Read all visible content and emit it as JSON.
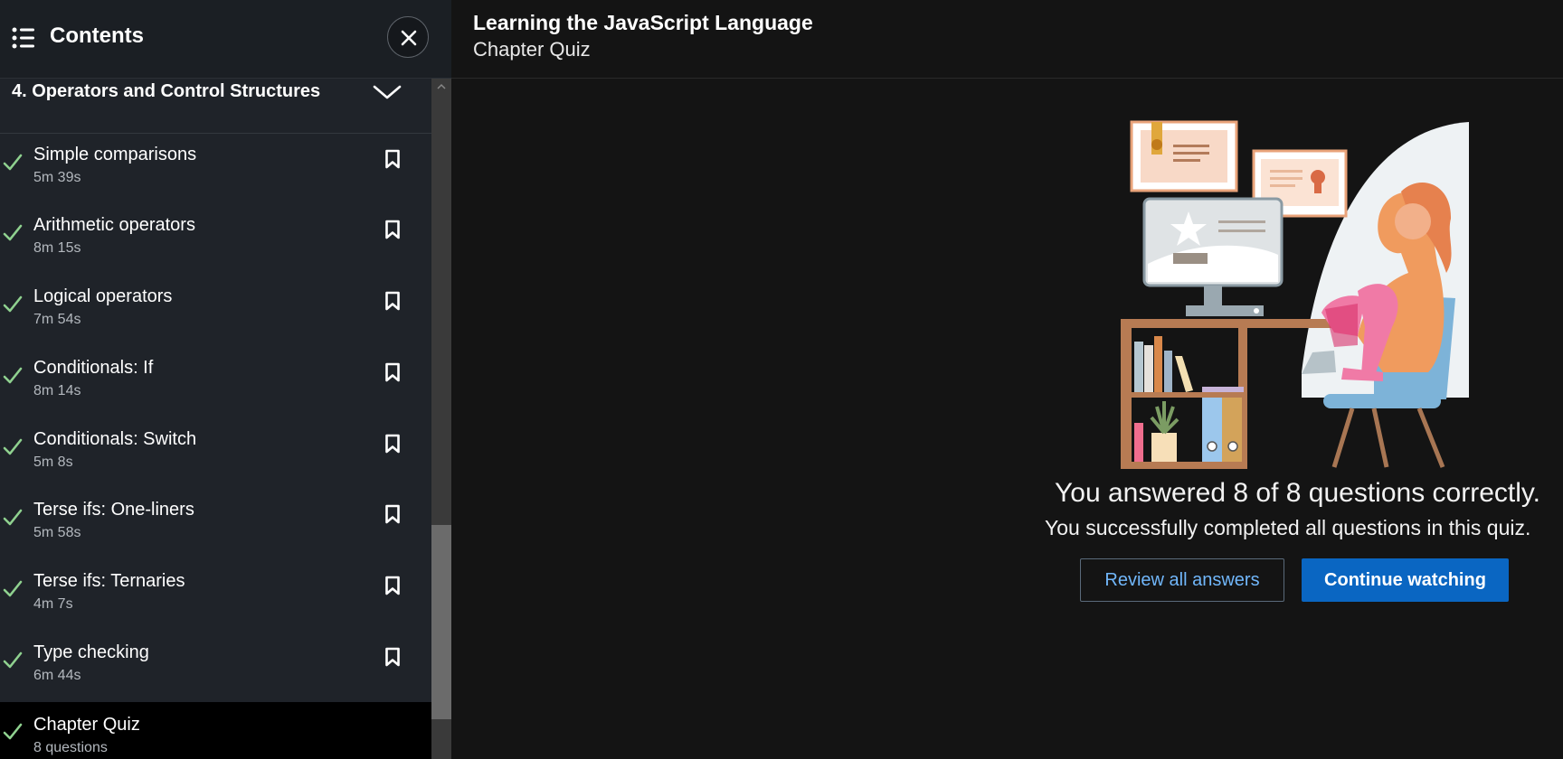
{
  "sidebar": {
    "title": "Contents",
    "section": {
      "title": "4. Operators and Control Structures"
    },
    "items": [
      {
        "title": "Simple comparisons",
        "duration": "5m 39s"
      },
      {
        "title": "Arithmetic operators",
        "duration": "8m 15s"
      },
      {
        "title": "Logical operators",
        "duration": "7m 54s"
      },
      {
        "title": "Conditionals: If",
        "duration": "8m 14s"
      },
      {
        "title": "Conditionals: Switch",
        "duration": "5m 8s"
      },
      {
        "title": "Terse ifs: One-liners",
        "duration": "5m 58s"
      },
      {
        "title": "Terse ifs: Ternaries",
        "duration": "4m 7s"
      },
      {
        "title": "Type checking",
        "duration": "6m 44s"
      },
      {
        "title": "Chapter Quiz",
        "duration": "8 questions"
      }
    ]
  },
  "header": {
    "course_title": "Learning the JavaScript Language",
    "chapter": "Chapter Quiz"
  },
  "result": {
    "main": "You answered 8 of 8 questions correctly.",
    "sub": "You successfully completed all questions in this quiz."
  },
  "buttons": {
    "review": "Review all answers",
    "continue": "Continue watching"
  },
  "colors": {
    "accent": "#0a66c2",
    "link": "#71b7fb",
    "check": "#8fd18f"
  }
}
